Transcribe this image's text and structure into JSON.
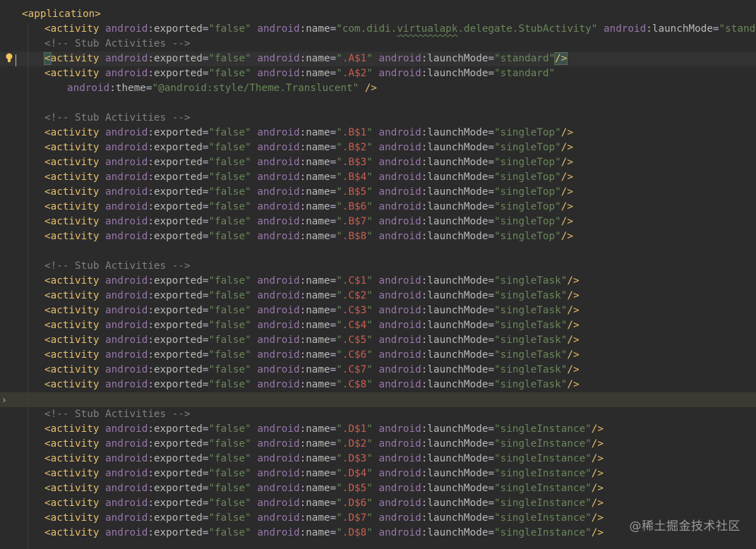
{
  "editor": {
    "application_open": "<application>",
    "header_activity": {
      "name": "com.didi.virtualapk.delegate.StubActivity",
      "name_squiggle": "virtualapk",
      "exported": "false",
      "launchMode": "standard"
    },
    "comment": "<!-- Stub Activities -->",
    "groups": [
      {
        "id": "A",
        "mode": "standard",
        "items": [
          {
            "name": ".A$1",
            "mode": "standard",
            "close": "/>"
          },
          {
            "name": ".A$2",
            "mode": "standard",
            "close": "",
            "theme_line": "android:theme=\"@android:style/Theme.Translucent\" />"
          }
        ]
      },
      {
        "id": "B",
        "mode": "singleTop",
        "items": [
          {
            "name": ".B$1"
          },
          {
            "name": ".B$2"
          },
          {
            "name": ".B$3"
          },
          {
            "name": ".B$4"
          },
          {
            "name": ".B$5"
          },
          {
            "name": ".B$6"
          },
          {
            "name": ".B$7"
          },
          {
            "name": ".B$8"
          }
        ]
      },
      {
        "id": "C",
        "mode": "singleTask",
        "items": [
          {
            "name": ".C$1"
          },
          {
            "name": ".C$2"
          },
          {
            "name": ".C$3"
          },
          {
            "name": ".C$4"
          },
          {
            "name": ".C$5"
          },
          {
            "name": ".C$6"
          },
          {
            "name": ".C$7"
          },
          {
            "name": ".C$8"
          }
        ]
      },
      {
        "id": "D",
        "mode": "singleInstance",
        "items": [
          {
            "name": ".D$1"
          },
          {
            "name": ".D$2"
          },
          {
            "name": ".D$3"
          },
          {
            "name": ".D$4"
          },
          {
            "name": ".D$5"
          },
          {
            "name": ".D$6"
          },
          {
            "name": ".D$7"
          },
          {
            "name": ".D$8"
          }
        ]
      }
    ]
  },
  "watermark": "@稀土掘金技术社区",
  "colors": {
    "background": "#2b2b2b",
    "tag": "#e8bf6a",
    "namespace": "#9876aa",
    "string": "#6a8759",
    "string_name": "#cc5d4f",
    "comment": "#808080"
  }
}
